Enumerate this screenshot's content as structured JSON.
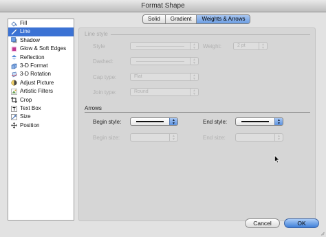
{
  "window": {
    "title": "Format Shape"
  },
  "tabs": [
    {
      "label": "Solid",
      "active": false
    },
    {
      "label": "Gradient",
      "active": false
    },
    {
      "label": "Weights & Arrows",
      "active": true
    }
  ],
  "sidebar": {
    "items": [
      {
        "label": "Fill",
        "icon": "paint-bucket-icon",
        "selected": false
      },
      {
        "label": "Line",
        "icon": "line-pen-icon",
        "selected": true
      },
      {
        "label": "Shadow",
        "icon": "shadow-icon",
        "selected": false
      },
      {
        "label": "Glow & Soft Edges",
        "icon": "glow-icon",
        "selected": false
      },
      {
        "label": "Reflection",
        "icon": "reflection-icon",
        "selected": false
      },
      {
        "label": "3-D Format",
        "icon": "3d-format-icon",
        "selected": false
      },
      {
        "label": "3-D Rotation",
        "icon": "3d-rotation-icon",
        "selected": false
      },
      {
        "label": "Adjust Picture",
        "icon": "adjust-picture-icon",
        "selected": false
      },
      {
        "label": "Artistic Filters",
        "icon": "artistic-filters-icon",
        "selected": false
      },
      {
        "label": "Crop",
        "icon": "crop-icon",
        "selected": false
      },
      {
        "label": "Text Box",
        "icon": "text-box-icon",
        "selected": false
      },
      {
        "label": "Size",
        "icon": "size-icon",
        "selected": false
      },
      {
        "label": "Position",
        "icon": "position-icon",
        "selected": false
      }
    ]
  },
  "line_style": {
    "title": "Line style",
    "style_label": "Style",
    "dashed_label": "Dashed:",
    "cap_type_label": "Cap type:",
    "cap_type_value": "Flat",
    "join_type_label": "Join type:",
    "join_type_value": "Round",
    "weight_label": "Weight:",
    "weight_value": "2 pt"
  },
  "arrows": {
    "title": "Arrows",
    "begin_style_label": "Begin style:",
    "end_style_label": "End style:",
    "begin_size_label": "Begin size:",
    "end_size_label": "End size:"
  },
  "buttons": {
    "cancel": "Cancel",
    "ok": "OK"
  },
  "colors": {
    "selection": "#3b72d4",
    "accent": "#4a86dd"
  }
}
